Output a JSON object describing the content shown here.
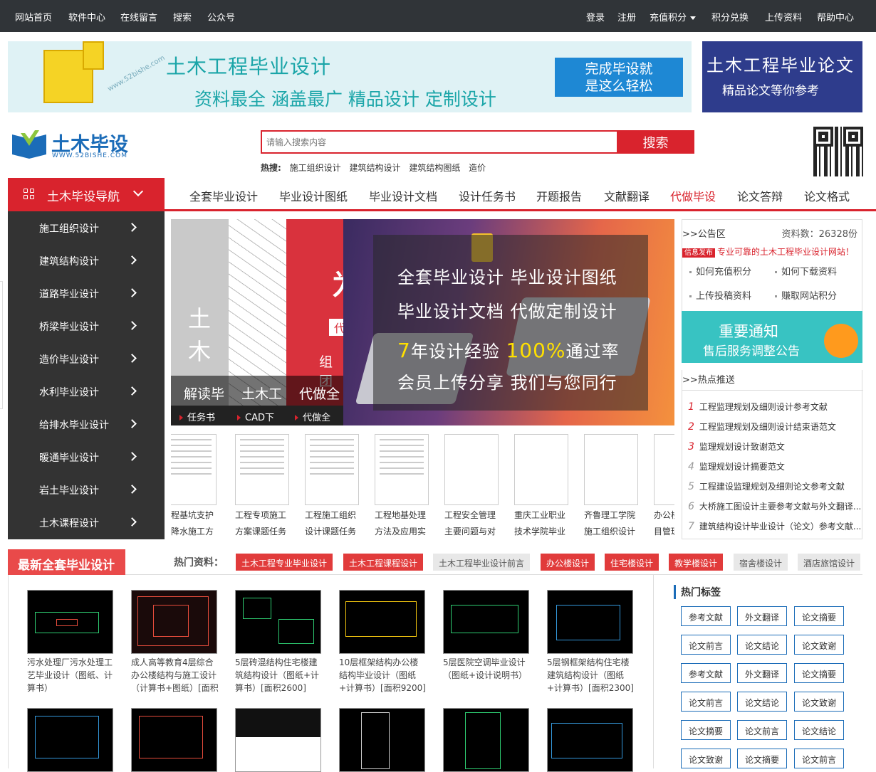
{
  "topnav": {
    "left": [
      "网站首页",
      "软件中心",
      "在线留言",
      "搜索",
      "公众号"
    ],
    "right": [
      "登录",
      "注册",
      "充值积分",
      "积分兑换",
      "上传资料",
      "帮助中心"
    ]
  },
  "banner": {
    "title": "土木工程毕业设计",
    "subtitle": "资料最全 涵盖最广 精品设计 定制设计",
    "button": "完成毕设就\n是这么轻松",
    "watermark": "www.52bishe.com"
  },
  "ad_right": {
    "line1": "土木工程毕业论文",
    "line2": "精品论文等你参考"
  },
  "logo": {
    "name": "土木毕设",
    "url": "WWW.52BISHE.COM"
  },
  "search": {
    "placeholder": "请输入搜索内容",
    "button": "搜索",
    "hot_label": "热搜:",
    "hot_terms": [
      "施工组织设计",
      "建筑结构设计",
      "建筑结构图纸",
      "造价"
    ]
  },
  "nav": {
    "button": "土木毕设导航",
    "items": [
      "全套毕业设计",
      "毕业设计图纸",
      "毕业设计文档",
      "设计任务书",
      "开题报告",
      "文献翻译",
      "代做毕设",
      "论文答辩",
      "论文格式"
    ]
  },
  "sidebar": [
    "施工组织设计",
    "建筑结构设计",
    "道路毕业设计",
    "桥梁毕业设计",
    "造价毕业设计",
    "水利毕业设计",
    "给排水毕业设计",
    "暖通毕业设计",
    "岩土毕业设计",
    "土木课程设计"
  ],
  "slider": {
    "panes": [
      {
        "caption": "解读毕",
        "sub": "任务书",
        "big": "土木"
      },
      {
        "caption": "土木工",
        "sub": "CAD下"
      },
      {
        "caption": "代做全",
        "sub": "代做全",
        "big": "代",
        "mid": "组团"
      }
    ],
    "main": {
      "line1": "全套毕业设计  毕业设计图纸",
      "line2": "毕业设计文档  代做定制设计",
      "line3a": "7",
      "line3b": "年设计经验  ",
      "line3c": "100%",
      "line3d": "通过率",
      "line4": "会员上传分享  我们与您同行"
    }
  },
  "thumbs": [
    {
      "t1": "工程基坑支护",
      "t2": "与降水施工方"
    },
    {
      "t1": "工程专项施工",
      "t2": "方案课题任务"
    },
    {
      "t1": "工程施工组织",
      "t2": "设计课题任务"
    },
    {
      "t1": "工程地基处理",
      "t2": "方法及应用实"
    },
    {
      "t1": "工程安全管理",
      "t2": "主要问题与对"
    },
    {
      "t1": "重庆工业职业",
      "t2": "技术学院毕业"
    },
    {
      "t1": "齐鲁理工学院",
      "t2": "施工组织设计"
    },
    {
      "t1": "办公楼",
      "t2": "目管理"
    }
  ],
  "notice": {
    "header": ">>公告区",
    "count": "资料数：26328份",
    "badge": "信息发布",
    "info": "专业可靠的土木工程毕业设计网站！",
    "links": [
      "如何充值积分",
      "如何下载资料",
      "上传投稿资料",
      "赚取网站积分"
    ]
  },
  "ad_notice": {
    "line1": "重要通知",
    "line2": "售后服务调整公告"
  },
  "hotpush": {
    "header": ">>热点推送",
    "items": [
      "工程监理规划及细则设计参考文献",
      "工程监理规划及细则设计结束语范文",
      "监理规划设计致谢范文",
      "监理规划设计摘要范文",
      "工程建设监理规划及细则论文参考文献",
      "大桥施工图设计主要参考文献与外文翻译...",
      "建筑结构设计毕业设计（论文）参考文献..."
    ]
  },
  "section": {
    "title": "最新全套毕业设计",
    "hot_label": "热门资料：",
    "tags": [
      {
        "t": "土木工程专业毕业设计",
        "s": "r"
      },
      {
        "t": "土木工程课程设计",
        "s": "r"
      },
      {
        "t": "土木工程毕业设计前言",
        "s": "g"
      },
      {
        "t": "办公楼设计",
        "s": "r"
      },
      {
        "t": "住宅楼设计",
        "s": "r"
      },
      {
        "t": "教学楼设计",
        "s": "r"
      },
      {
        "t": "宿舍楼设计",
        "s": "g"
      },
      {
        "t": "酒店旅馆设计",
        "s": "g"
      }
    ]
  },
  "cards": [
    "污水处理厂污水处理工\n艺毕业设计（图纸、计\n算书）",
    "成人高等教育4层综合\n办公楼结构与施工设计\n（计算书+图纸）[面积",
    "5层砖混结构住宅楼建\n筑结构设计（图纸+计\n算书）[面积2600]",
    "10层框架结构办公楼\n结构毕业设计（图纸\n+计算书）[面积9200]",
    "5层医院空调毕业设计\n（图纸+设计说明书）",
    "5层钢框架结构住宅楼\n建筑结构设计（图纸\n+计算书）[面积2300]"
  ],
  "tags": {
    "header": "热门标签",
    "items": [
      "参考文献",
      "外文翻译",
      "论文摘要",
      "论文前言",
      "论文结论",
      "论文致谢",
      "参考文献",
      "外文翻译",
      "论文摘要",
      "论文前言",
      "论文结论",
      "论文致谢",
      "论文摘要",
      "论文前言",
      "论文结论",
      "论文致谢",
      "论文摘要",
      "论文前言"
    ]
  }
}
